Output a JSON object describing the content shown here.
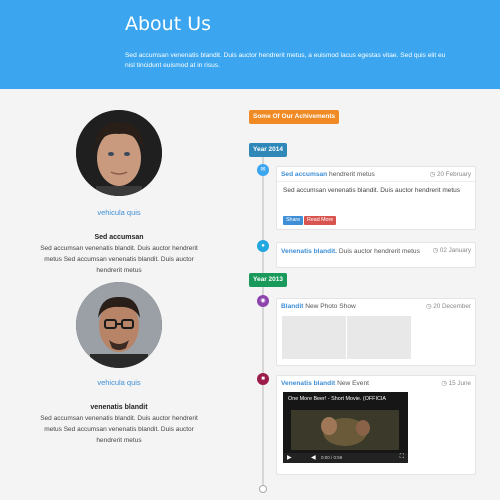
{
  "header": {
    "title": "About Us",
    "intro": "Sed accumsan venenatis blandit. Duis auctor hendrerit metus, a euismod lacus egestas vitae. Sed quis elit eu nisl tincidunt euismod at in risus."
  },
  "people": [
    {
      "name": "vehicula quis",
      "title": "Sed accumsan",
      "text": "Sed accumsan venenatis blandit. Duis auctor hendrerit metus Sed accumsan venenatis blandit. Duis auctor hendrerit metus"
    },
    {
      "name": "vehicula quis",
      "title": "venenatis blandit",
      "text": "Sed accumsan venenatis blandit. Duis auctor hendrerit metus Sed accumsan venenatis blandit. Duis auctor hendrerit metus"
    }
  ],
  "timeline": {
    "heading": "Some Of Our Achivements",
    "years": [
      "Year 2014",
      "Year 2013"
    ],
    "entries": [
      {
        "title": "Sed accumsan",
        "subtitle": "hendrerit metus",
        "date": "20 February",
        "body": "Sed accumsan venenatis blandit. Duis auctor hendrerit metus",
        "share_label": "Share",
        "more_label": "Read More",
        "icon": "envelope-icon",
        "color": "#3ba6ef"
      },
      {
        "title": "Venenatis blandit.",
        "subtitle": "Duis auctor hendrerit metus",
        "date": "02 January",
        "icon": "user-icon",
        "color": "#22a7e0"
      },
      {
        "title": "Blandit",
        "subtitle": "New Photo Show",
        "date": "20 December",
        "icon": "camera-icon",
        "color": "#8e44ad"
      },
      {
        "title": "Venenatis blandit",
        "subtitle": "New Event",
        "date": "15 June",
        "video_title": "One More Beer! - Short Movie. (OFFICIA",
        "video_time": "0:00 / 0:59",
        "icon": "video-icon",
        "color": "#9b1b4b"
      }
    ]
  },
  "colors": {
    "header_blue": "#3ba6ef",
    "link_blue": "#3f8fd6",
    "achievement_orange": "#f08a24",
    "year_2014_blue": "#2f88b8",
    "year_2013_green": "#1a9a5a",
    "share_blue": "#3f8fd6",
    "read_more_red": "#d9534f"
  }
}
